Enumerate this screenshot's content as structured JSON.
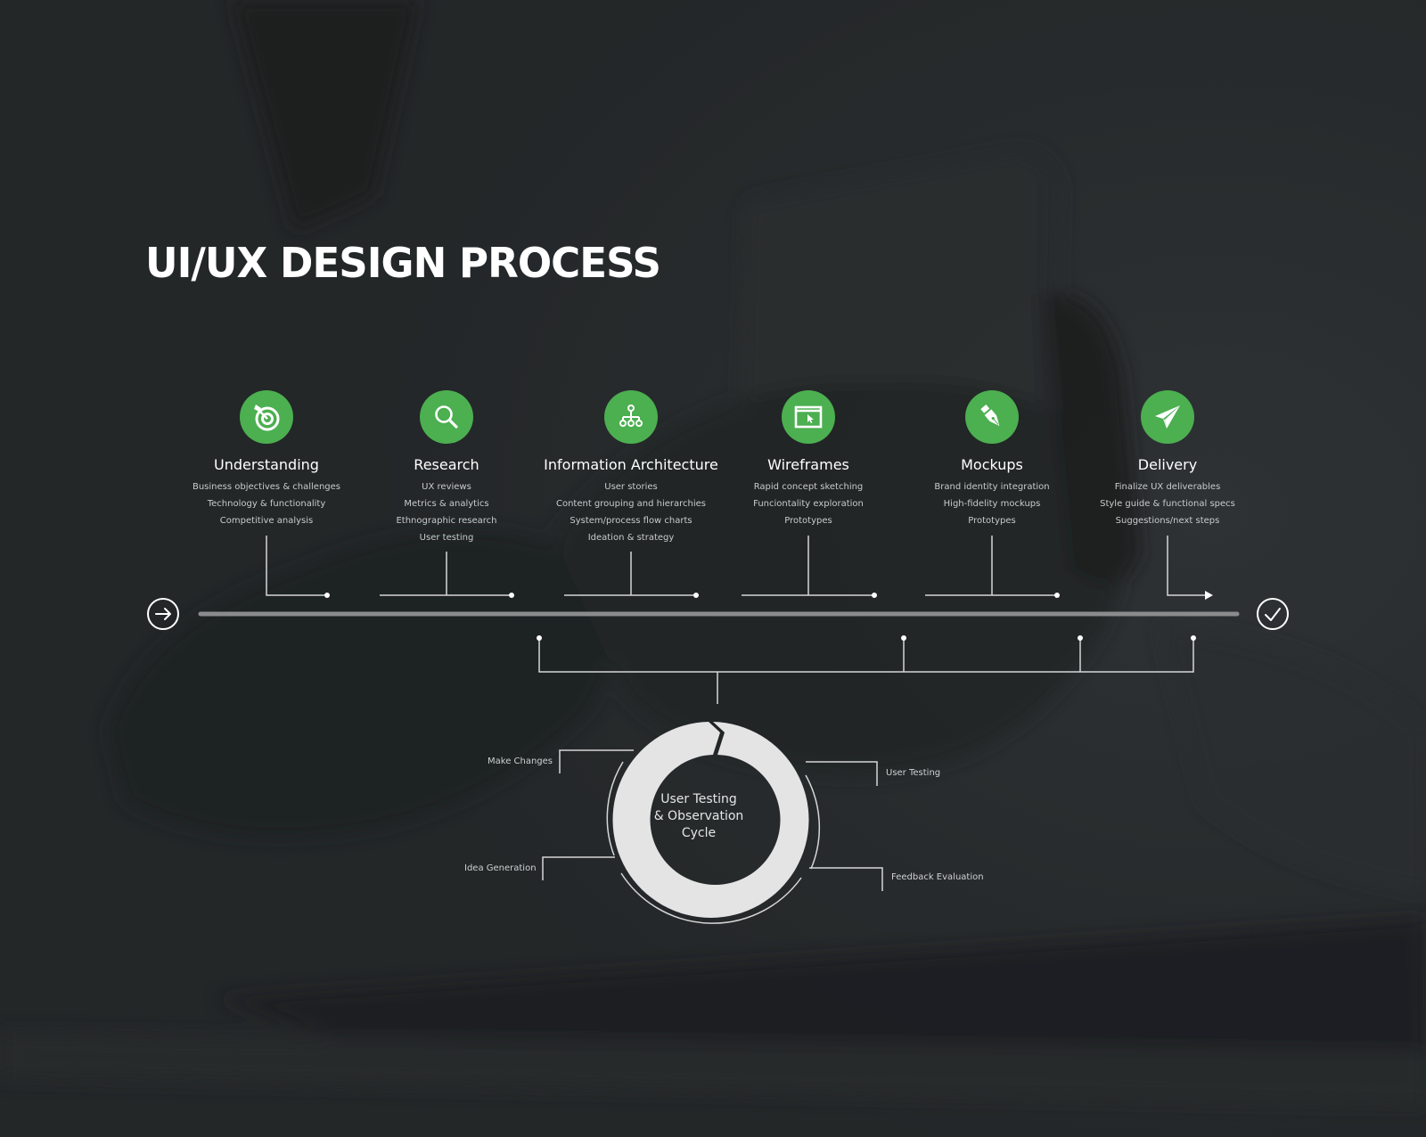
{
  "title": "UI/UX DESIGN PROCESS",
  "colors": {
    "background": "#25282a",
    "accent_green": "#4caf50",
    "line": "#d9d9d9",
    "timeline_bar": "#8a8b8c",
    "ring": "#e4e4e5"
  },
  "timeline": {
    "start_icon": "arrow-right-circle-icon",
    "end_icon": "check-circle-icon"
  },
  "steps": [
    {
      "name": "Understanding",
      "icon": "target-icon",
      "items": [
        "Business objectives & challenges",
        "Technology & functionality",
        "Competitive analysis"
      ]
    },
    {
      "name": "Research",
      "icon": "search-icon",
      "items": [
        "UX reviews",
        "Metrics & analytics",
        "Ethnographic research",
        "User testing"
      ]
    },
    {
      "name": "Information Architecture",
      "icon": "sitemap-icon",
      "items": [
        "User stories",
        "Content grouping and hierarchies",
        "System/process flow charts",
        "Ideation & strategy"
      ]
    },
    {
      "name": "Wireframes",
      "icon": "browser-cursor-icon",
      "items": [
        "Rapid concept sketching",
        "Funciontality exploration",
        "Prototypes"
      ]
    },
    {
      "name": "Mockups",
      "icon": "pen-nib-icon",
      "items": [
        "Brand identity integration",
        "High-fidelity mockups",
        "Prototypes"
      ]
    },
    {
      "name": "Delivery",
      "icon": "paper-plane-icon",
      "items": [
        "Finalize UX deliverables",
        "Style guide & functional specs",
        "Suggestions/next steps"
      ]
    }
  ],
  "cycle": {
    "center_lines": [
      "User Testing",
      "& Observation",
      "Cycle"
    ],
    "labels": {
      "make_changes": "Make Changes",
      "user_testing": "User Testing",
      "idea_generation": "Idea Generation",
      "feedback_evaluation": "Feedback Evaluation"
    }
  }
}
